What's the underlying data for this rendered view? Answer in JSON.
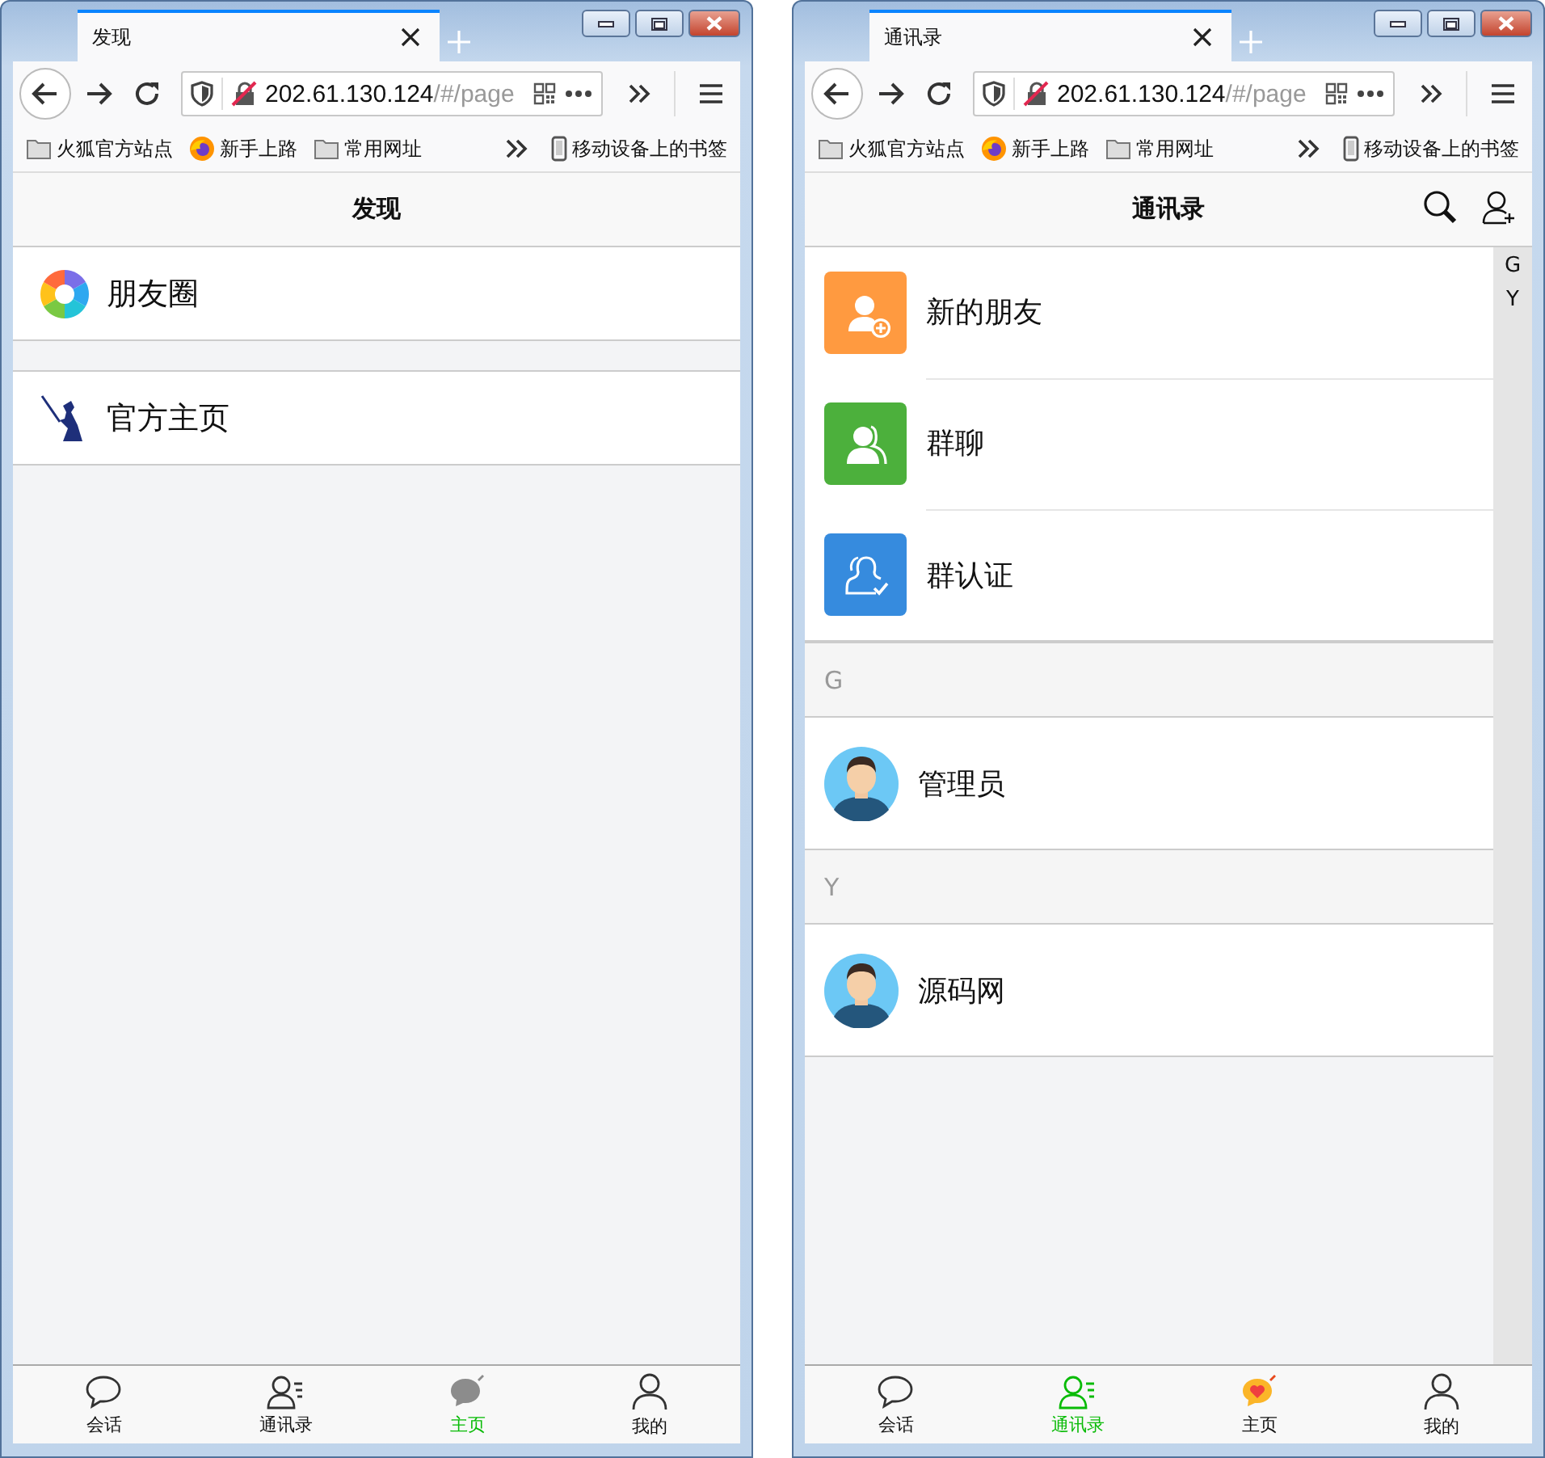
{
  "windows": [
    {
      "tab": {
        "title": "发现"
      },
      "address": {
        "host": "202.61.130.124",
        "path": "/#/page"
      },
      "bookmarks": [
        {
          "label": "火狐官方站点",
          "kind": "folder"
        },
        {
          "label": "新手上路",
          "kind": "firefox"
        },
        {
          "label": "常用网址",
          "kind": "folder"
        }
      ],
      "mobile_bookmarks": "移动设备上的书签",
      "page": {
        "kind": "discover",
        "title": "发现",
        "groups": [
          {
            "items": [
              {
                "label": "朋友圈",
                "kind": "aperture"
              }
            ]
          },
          {
            "items": [
              {
                "label": "官方主页",
                "kind": "swordsman"
              }
            ]
          }
        ]
      },
      "tabbar": [
        {
          "label": "会话",
          "kind": "chat",
          "selected": false
        },
        {
          "label": "通讯录",
          "kind": "contacts",
          "selected": false
        },
        {
          "label": "主页",
          "kind": "bubble",
          "selected": true
        },
        {
          "label": "我的",
          "kind": "person",
          "selected": false
        }
      ]
    },
    {
      "tab": {
        "title": "通讯录"
      },
      "address": {
        "host": "202.61.130.124",
        "path": "/#/page"
      },
      "bookmarks": [
        {
          "label": "火狐官方站点",
          "kind": "folder"
        },
        {
          "label": "新手上路",
          "kind": "firefox"
        },
        {
          "label": "常用网址",
          "kind": "folder"
        }
      ],
      "mobile_bookmarks": "移动设备上的书签",
      "page": {
        "kind": "contacts",
        "title": "通讯录",
        "actions": [
          {
            "kind": "search"
          },
          {
            "kind": "add-user"
          }
        ],
        "functions": [
          {
            "label": "新的朋友",
            "kind": "add-friend",
            "color": "#ff9a40"
          },
          {
            "label": "群聊",
            "kind": "group",
            "color": "#4cb03c"
          },
          {
            "label": "群认证",
            "kind": "verify",
            "color": "#368bde"
          }
        ],
        "sections": [
          {
            "letter": "G",
            "contacts": [
              {
                "name": "管理员"
              }
            ]
          },
          {
            "letter": "Y",
            "contacts": [
              {
                "name": "源码网"
              }
            ]
          }
        ],
        "index": [
          "G",
          "Y"
        ]
      },
      "tabbar": [
        {
          "label": "会话",
          "kind": "chat",
          "selected": false
        },
        {
          "label": "通讯录",
          "kind": "contacts",
          "selected": true
        },
        {
          "label": "主页",
          "kind": "heart-bubble",
          "selected": false
        },
        {
          "label": "我的",
          "kind": "person",
          "selected": false
        }
      ]
    }
  ]
}
